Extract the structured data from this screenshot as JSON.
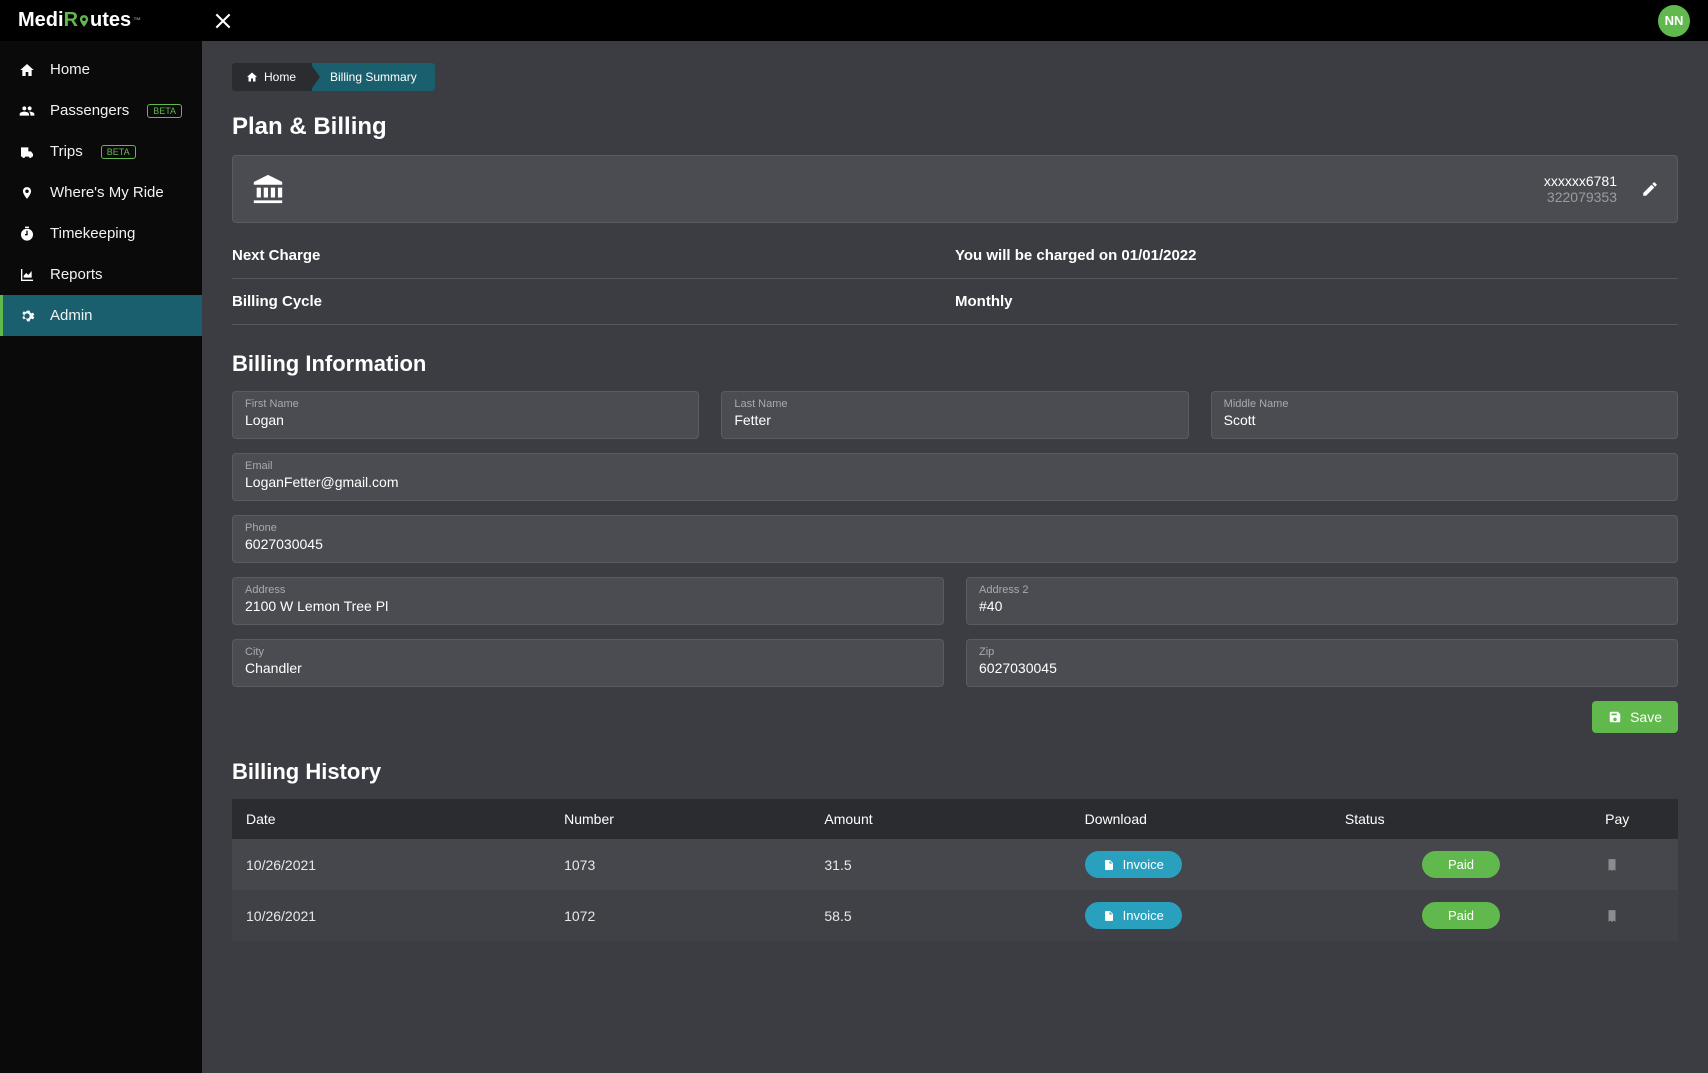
{
  "header": {
    "logo_part1": "Medi",
    "logo_part2": "R",
    "logo_part3": "utes",
    "avatar_initials": "NN"
  },
  "sidebar": {
    "items": [
      {
        "label": "Home",
        "icon": "home-icon"
      },
      {
        "label": "Passengers",
        "icon": "passengers-icon",
        "beta": "BETA"
      },
      {
        "label": "Trips",
        "icon": "trips-icon",
        "beta": "BETA"
      },
      {
        "label": "Where's My Ride",
        "icon": "location-icon"
      },
      {
        "label": "Timekeeping",
        "icon": "stopwatch-icon"
      },
      {
        "label": "Reports",
        "icon": "reports-icon"
      },
      {
        "label": "Admin",
        "icon": "admin-icon"
      }
    ]
  },
  "breadcrumb": {
    "home": "Home",
    "current": "Billing Summary"
  },
  "page": {
    "title": "Plan & Billing",
    "account_masked": "xxxxxx6781",
    "routing": "322079353",
    "next_charge_label": "Next Charge",
    "next_charge_value": "You will be charged on 01/01/2022",
    "cycle_label": "Billing Cycle",
    "cycle_value": "Monthly"
  },
  "billing_info": {
    "title": "Billing Information",
    "fields": {
      "first_name": {
        "label": "First Name",
        "value": "Logan"
      },
      "last_name": {
        "label": "Last Name",
        "value": "Fetter"
      },
      "middle_name": {
        "label": "Middle Name",
        "value": "Scott"
      },
      "email": {
        "label": "Email",
        "value": "LoganFetter@gmail.com"
      },
      "phone": {
        "label": "Phone",
        "value": "6027030045"
      },
      "address": {
        "label": "Address",
        "value": "2100 W Lemon Tree Pl"
      },
      "address2": {
        "label": "Address 2",
        "value": "#40"
      },
      "city": {
        "label": "City",
        "value": "Chandler"
      },
      "zip": {
        "label": "Zip",
        "value": "6027030045"
      }
    },
    "save_label": "Save"
  },
  "history": {
    "title": "Billing History",
    "columns": {
      "date": "Date",
      "number": "Number",
      "amount": "Amount",
      "download": "Download",
      "status": "Status",
      "pay": "Pay"
    },
    "invoice_label": "Invoice",
    "paid_label": "Paid",
    "rows": [
      {
        "date": "10/26/2021",
        "number": "1073",
        "amount": "31.5"
      },
      {
        "date": "10/26/2021",
        "number": "1072",
        "amount": "58.5"
      }
    ]
  }
}
